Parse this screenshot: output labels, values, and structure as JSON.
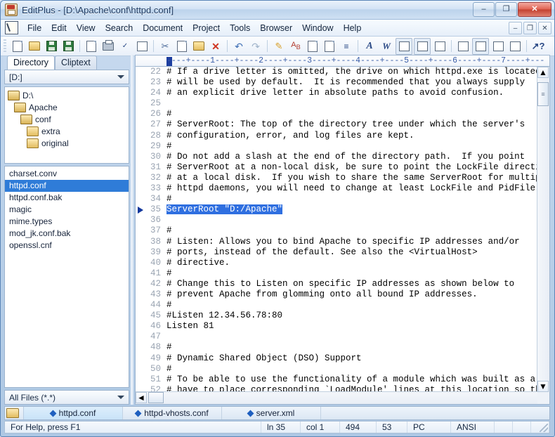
{
  "window": {
    "title": "EditPlus - [D:\\Apache\\conf\\httpd.conf]",
    "app_icon": "editplus-icon",
    "minimize": "–",
    "maximize": "❐",
    "close": "✕"
  },
  "menubar": {
    "items": [
      "File",
      "Edit",
      "View",
      "Search",
      "Document",
      "Project",
      "Tools",
      "Browser",
      "Window",
      "Help"
    ],
    "mdi_minimize": "–",
    "mdi_restore": "❐",
    "mdi_close": "✕"
  },
  "toolbar": {
    "buttons": [
      {
        "name": "new-file-button",
        "title": "New"
      },
      {
        "name": "open-file-button",
        "title": "Open"
      },
      {
        "name": "save-button",
        "title": "Save"
      },
      {
        "name": "save-all-button",
        "title": "Save All"
      },
      {
        "name": "print-preview-button",
        "title": "Print Preview"
      },
      {
        "name": "print-button",
        "title": "Print"
      },
      {
        "name": "spell-check-button",
        "title": "Spell Check"
      },
      {
        "name": "browser-preview-button",
        "title": "Preview in Browser"
      },
      {
        "name": "cut-button",
        "title": "Cut"
      },
      {
        "name": "copy-button",
        "title": "Copy"
      },
      {
        "name": "paste-button",
        "title": "Paste"
      },
      {
        "name": "delete-button",
        "title": "Delete"
      },
      {
        "name": "undo-button",
        "title": "Undo"
      },
      {
        "name": "redo-button",
        "title": "Redo"
      },
      {
        "name": "highlight-button",
        "title": "Highlight"
      },
      {
        "name": "find-button",
        "title": "Find"
      },
      {
        "name": "replace-button",
        "title": "Replace"
      },
      {
        "name": "copy-lines-button",
        "title": "Duplicate"
      },
      {
        "name": "indent-button",
        "title": "Indent"
      },
      {
        "name": "font-button",
        "title": "Font"
      },
      {
        "name": "word-wrap-button",
        "title": "Word Wrap"
      },
      {
        "name": "line-numbers-button",
        "title": "Line Numbers"
      },
      {
        "name": "column-mode-button",
        "title": "Column Mode"
      },
      {
        "name": "user-tools-button",
        "title": "User Tools"
      },
      {
        "name": "document-selector-button",
        "title": "Document Selector"
      },
      {
        "name": "directory-window-button",
        "title": "Directory Window"
      },
      {
        "name": "clip-library-button",
        "title": "Cliptext Window"
      },
      {
        "name": "output-window-button",
        "title": "Output Window"
      },
      {
        "name": "help-pointer-button",
        "title": "Context Help"
      }
    ]
  },
  "ruler": {
    "marks": "----+----1----+----2----+----3----+----4----+----5----+----6----+----7----+---"
  },
  "sidebar": {
    "tabs": [
      {
        "label": "Directory",
        "selected": true
      },
      {
        "label": "Cliptext",
        "selected": false
      }
    ],
    "drive_selector": {
      "value": "[D:]",
      "icon": "chevron-down-icon"
    },
    "tree": [
      {
        "label": "D:\\",
        "indent": 0,
        "icon": "folder-open-icon"
      },
      {
        "label": "Apache",
        "indent": 1,
        "icon": "folder-open-icon"
      },
      {
        "label": "conf",
        "indent": 2,
        "icon": "folder-open-icon"
      },
      {
        "label": "extra",
        "indent": 3,
        "icon": "folder-icon"
      },
      {
        "label": "original",
        "indent": 3,
        "icon": "folder-icon"
      }
    ],
    "files": [
      {
        "name": "charset.conv",
        "selected": false
      },
      {
        "name": "httpd.conf",
        "selected": true
      },
      {
        "name": "httpd.conf.bak",
        "selected": false
      },
      {
        "name": "magic",
        "selected": false
      },
      {
        "name": "mime.types",
        "selected": false
      },
      {
        "name": "mod_jk.conf.bak",
        "selected": false
      },
      {
        "name": "openssl.cnf",
        "selected": false
      }
    ],
    "filter": {
      "value": "All Files (*.*)",
      "icon": "chevron-down-icon"
    }
  },
  "editor": {
    "first_visible_line": 22,
    "highlight_line": 35,
    "marker_line": 35,
    "lines": [
      {
        "num": 22,
        "text": "# If a drive letter is omitted, the drive on which httpd.exe is located"
      },
      {
        "num": 23,
        "text": "# will be used by default.  It is recommended that you always supply"
      },
      {
        "num": 24,
        "text": "# an explicit drive letter in absolute paths to avoid confusion."
      },
      {
        "num": 25,
        "text": ""
      },
      {
        "num": 26,
        "text": "#"
      },
      {
        "num": 27,
        "text": "# ServerRoot: The top of the directory tree under which the server's"
      },
      {
        "num": 28,
        "text": "# configuration, error, and log files are kept."
      },
      {
        "num": 29,
        "text": "#"
      },
      {
        "num": 30,
        "text": "# Do not add a slash at the end of the directory path.  If you point"
      },
      {
        "num": 31,
        "text": "# ServerRoot at a non-local disk, be sure to point the LockFile directive"
      },
      {
        "num": 32,
        "text": "# at a local disk.  If you wish to share the same ServerRoot for multiple"
      },
      {
        "num": 33,
        "text": "# httpd daemons, you will need to change at least LockFile and PidFile."
      },
      {
        "num": 34,
        "text": "#"
      },
      {
        "num": 35,
        "text": "ServerRoot \"D:/Apache\"",
        "selected": true
      },
      {
        "num": 36,
        "text": ""
      },
      {
        "num": 37,
        "text": "#"
      },
      {
        "num": 38,
        "text": "# Listen: Allows you to bind Apache to specific IP addresses and/or"
      },
      {
        "num": 39,
        "text": "# ports, instead of the default. See also the <VirtualHost>"
      },
      {
        "num": 40,
        "text": "# directive."
      },
      {
        "num": 41,
        "text": "#"
      },
      {
        "num": 42,
        "text": "# Change this to Listen on specific IP addresses as shown below to"
      },
      {
        "num": 43,
        "text": "# prevent Apache from glomming onto all bound IP addresses."
      },
      {
        "num": 44,
        "text": "#"
      },
      {
        "num": 45,
        "text": "#Listen 12.34.56.78:80"
      },
      {
        "num": 46,
        "text": "Listen 81"
      },
      {
        "num": 47,
        "text": ""
      },
      {
        "num": 48,
        "text": "#"
      },
      {
        "num": 49,
        "text": "# Dynamic Shared Object (DSO) Support"
      },
      {
        "num": 50,
        "text": "#"
      },
      {
        "num": 51,
        "text": "# To be able to use the functionality of a module which was built as a DSO yo"
      },
      {
        "num": 52,
        "text": "# have to place corresponding `LoadModule' lines at this location so the"
      }
    ],
    "scrollbar": {
      "up_arrow": "▲",
      "down_arrow": "▼",
      "left_arrow": "◄",
      "right_arrow": "►",
      "thumb_grip": "≡"
    }
  },
  "file_tabs": {
    "folder_icon": "folder-icon",
    "tabs": [
      {
        "label": "httpd.conf",
        "selected": true
      },
      {
        "label": "httpd-vhosts.conf",
        "selected": false
      },
      {
        "label": "server.xml",
        "selected": false
      }
    ]
  },
  "statusbar": {
    "help": "For Help, press F1",
    "line": "ln 35",
    "col": "col 1",
    "chars": "494",
    "value2": "53",
    "mode": "PC",
    "encoding": "ANSI"
  },
  "colors": {
    "accent": "#2f6fe0",
    "selection": "#2f7cd8",
    "title_text": "#1f3c63",
    "close_button": "#c2402f",
    "ruler_text": "#3a5ea8",
    "line_number": "#9aa4b2",
    "marker": "#12379c"
  }
}
